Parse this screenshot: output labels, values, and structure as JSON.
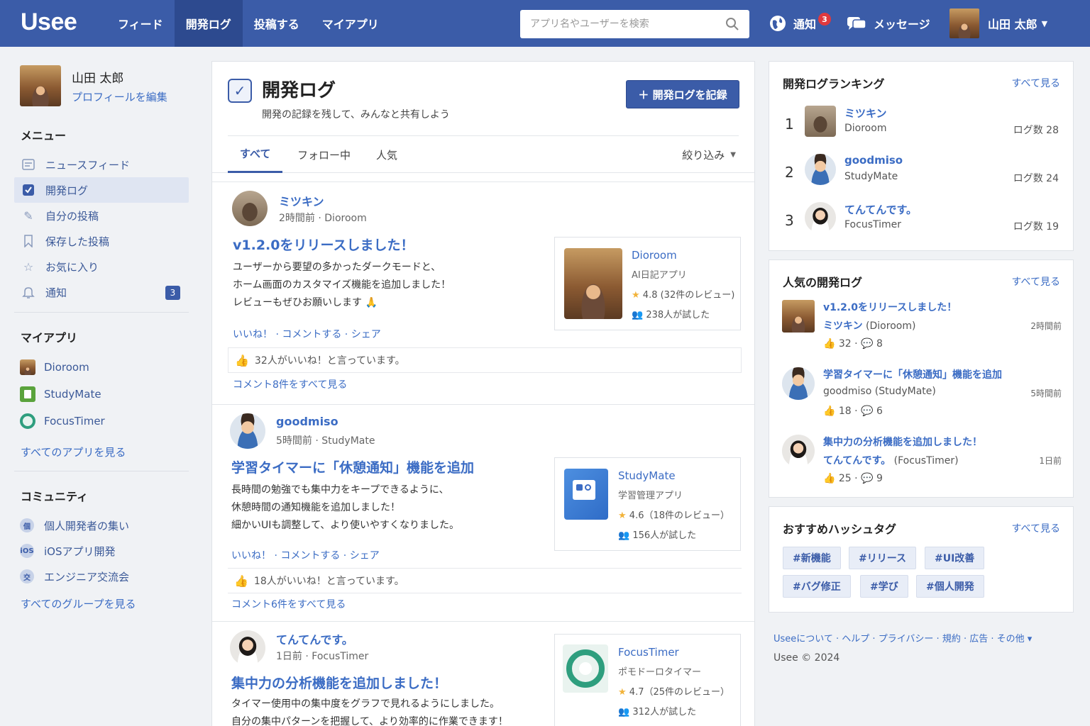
{
  "header": {
    "logo": "Usee",
    "nav": [
      "フィード",
      "開発ログ",
      "投稿する",
      "マイアプリ"
    ],
    "search_placeholder": "アプリ名やユーザーを検索",
    "notify_label": "通知",
    "notify_count": "3",
    "messages_label": "メッセージ",
    "user_name": "山田 太郎"
  },
  "sidebar": {
    "profile_name": "山田 太郎",
    "profile_edit": "プロフィールを編集",
    "menu_title": "メニュー",
    "menu": [
      {
        "label": "ニュースフィード",
        "icon": "newspaper-icon"
      },
      {
        "label": "開発ログ",
        "icon": "checkbox-icon"
      },
      {
        "label": "自分の投稿",
        "icon": "pencil-icon"
      },
      {
        "label": "保存した投稿",
        "icon": "bookmark-icon"
      },
      {
        "label": "お気に入り",
        "icon": "star-icon"
      },
      {
        "label": "通知",
        "icon": "bell-icon",
        "badge": "3"
      }
    ],
    "apps_title": "マイアプリ",
    "apps": [
      "Dioroom",
      "StudyMate",
      "FocusTimer"
    ],
    "apps_see_all": "すべてのアプリを見る",
    "community_title": "コミュニティ",
    "groups": [
      "個人開発者の集い",
      "iOSアプリ開発",
      "エンジニア交流会"
    ],
    "groups_see_all": "すべてのグループを見る"
  },
  "main": {
    "title": "開発ログ",
    "subtitle": "開発の記録を残して、みんなと共有しよう",
    "new_button": "＋ 開発ログを記録",
    "tabs": [
      "すべて",
      "フォロー中",
      "人気"
    ],
    "filter": "絞り込み",
    "posts": [
      {
        "author": "ミツキン",
        "time": "2時間前",
        "app": "Dioroom",
        "title": "v1.2.0をリリースしました！",
        "body": [
          "ユーザーから要望の多かったダークモードと、",
          "ホーム画面のカスタマイズ機能を追加しました！",
          "レビューもぜひお願いします 🙏"
        ],
        "like": "いいね！",
        "comment": "コメントする",
        "share": "シェア",
        "likes_text": "32人がいいね！と言っています。",
        "comments_link": "コメント8件をすべて見る",
        "card": {
          "name": "Dioroom",
          "category": "AI日記アプリ",
          "rating": "4.8 (32件のレビュー)",
          "tried": "238人が試した"
        }
      },
      {
        "author": "goodmiso",
        "time": "5時間前",
        "app": "StudyMate",
        "title": "学習タイマーに「休憩通知」機能を追加",
        "body": [
          "長時間の勉強でも集中力をキープできるように、",
          "休憩時間の通知機能を追加しました！",
          "細かいUIも調整して、より使いやすくなりました。"
        ],
        "like": "いいね！",
        "comment": "コメントする",
        "share": "シェア",
        "likes_text": "18人がいいね！と言っています。",
        "comments_link": "コメント6件をすべて見る",
        "card": {
          "name": "StudyMate",
          "category": "学習管理アプリ",
          "rating": "4.6（18件のレビュー）",
          "tried": "156人が試した"
        }
      },
      {
        "author": "てんてんです。",
        "time": "1日前",
        "app": "FocusTimer",
        "title": "集中力の分析機能を追加しました！",
        "body": [
          "タイマー使用中の集中度をグラフで見れるようにしました。",
          "自分の集中パターンを把握して、より効率的に作業できます！"
        ],
        "card": {
          "name": "FocusTimer",
          "category": "ポモドーロタイマー",
          "rating": "4.7（25件のレビュー）",
          "tried": "312人が試した"
        }
      }
    ]
  },
  "right": {
    "ranking_title": "開発ログランキング",
    "see_all": "すべて見る",
    "ranking": [
      {
        "rank": "1",
        "name": "ミツキン",
        "app": "Dioroom",
        "count": "ログ数 28"
      },
      {
        "rank": "2",
        "name": "goodmiso",
        "app": "StudyMate",
        "count": "ログ数 24"
      },
      {
        "rank": "3",
        "name": "てんてんです。",
        "app": "FocusTimer",
        "count": "ログ数 19"
      }
    ],
    "popular_title": "人気の開発ログ",
    "popular": [
      {
        "title": "v1.2.0をリリースしました！",
        "author": "ミツキン",
        "app": "(Dioroom)",
        "time": "2時間前",
        "likes": "32",
        "comments": "8"
      },
      {
        "title": "学習タイマーに「休憩通知」機能を追加",
        "author": "goodmiso",
        "app": "(StudyMate)",
        "time": "5時間前",
        "likes": "18",
        "comments": "6"
      },
      {
        "title": "集中力の分析機能を追加しました！",
        "author": "てんてんです。",
        "app": "(FocusTimer)",
        "time": "1日前",
        "likes": "25",
        "comments": "9"
      }
    ],
    "hashtag_title": "おすすめハッシュタグ",
    "hashtags": [
      "#新機能",
      "#リリース",
      "#UI改善",
      "#バグ修正",
      "#学び",
      "#個人開発"
    ],
    "footer_links": "Useeについて · ヘルプ · プライバシー · 規約 · 広告 · その他 ▾",
    "copyright": "Usee © 2024"
  }
}
